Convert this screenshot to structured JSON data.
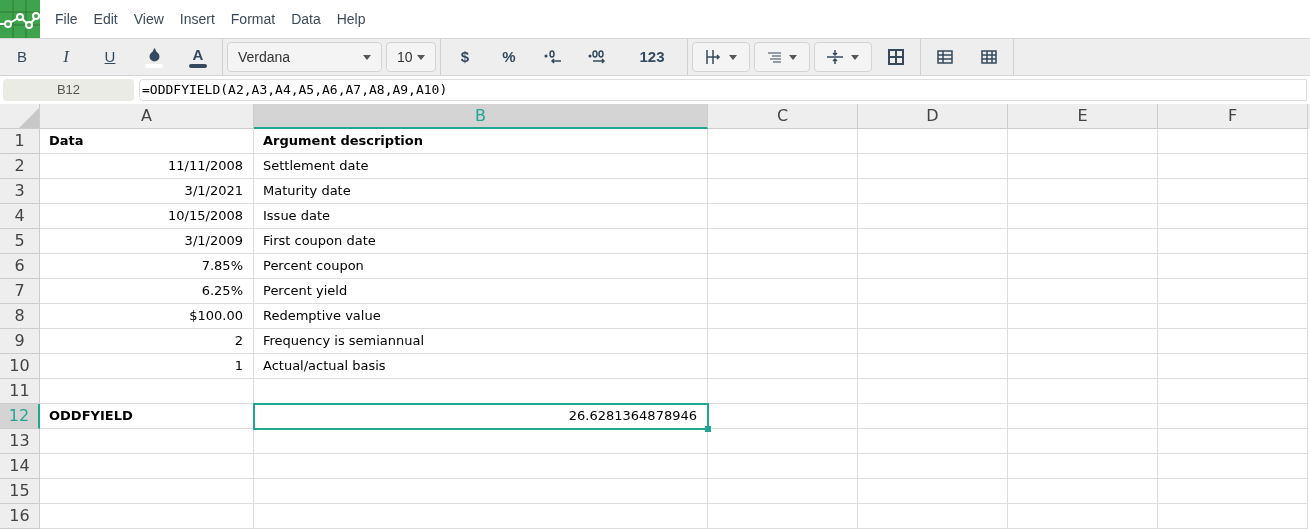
{
  "menu": [
    "File",
    "Edit",
    "View",
    "Insert",
    "Format",
    "Data",
    "Help"
  ],
  "toolbar": {
    "bold": "B",
    "italic": "I",
    "underline": "U",
    "text_color": "A",
    "currency": "$",
    "percent": "%",
    "font": "Verdana",
    "size": "10",
    "number_format": "123"
  },
  "formula_bar": {
    "cell": "B12",
    "formula": "=ODDFYIELD(A2,A3,A4,A5,A6,A7,A8,A9,A10)"
  },
  "columns": [
    {
      "label": "A",
      "selected": false
    },
    {
      "label": "B",
      "selected": true
    },
    {
      "label": "C",
      "selected": false
    },
    {
      "label": "D",
      "selected": false
    },
    {
      "label": "E",
      "selected": false
    },
    {
      "label": "F",
      "selected": false
    }
  ],
  "rows": [
    {
      "number": "1",
      "selected": false,
      "cells": [
        {
          "text": "Data",
          "kind": "text",
          "bold": true,
          "selected": false
        },
        {
          "text": "Argument description",
          "kind": "text",
          "bold": true,
          "selected": false
        }
      ]
    },
    {
      "number": "2",
      "selected": false,
      "cells": [
        {
          "text": "11/11/2008",
          "kind": "number",
          "bold": false,
          "selected": false
        },
        {
          "text": "Settlement date",
          "kind": "text",
          "bold": false,
          "selected": false
        }
      ]
    },
    {
      "number": "3",
      "selected": false,
      "cells": [
        {
          "text": "3/1/2021",
          "kind": "number",
          "bold": false,
          "selected": false
        },
        {
          "text": "Maturity date",
          "kind": "text",
          "bold": false,
          "selected": false
        }
      ]
    },
    {
      "number": "4",
      "selected": false,
      "cells": [
        {
          "text": "10/15/2008",
          "kind": "number",
          "bold": false,
          "selected": false
        },
        {
          "text": "Issue date",
          "kind": "text",
          "bold": false,
          "selected": false
        }
      ]
    },
    {
      "number": "5",
      "selected": false,
      "cells": [
        {
          "text": "3/1/2009",
          "kind": "number",
          "bold": false,
          "selected": false
        },
        {
          "text": "First coupon date",
          "kind": "text",
          "bold": false,
          "selected": false
        }
      ]
    },
    {
      "number": "6",
      "selected": false,
      "cells": [
        {
          "text": "7.85%",
          "kind": "number",
          "bold": false,
          "selected": false
        },
        {
          "text": "Percent coupon",
          "kind": "text",
          "bold": false,
          "selected": false
        }
      ]
    },
    {
      "number": "7",
      "selected": false,
      "cells": [
        {
          "text": "6.25%",
          "kind": "number",
          "bold": false,
          "selected": false
        },
        {
          "text": "Percent yield",
          "kind": "text",
          "bold": false,
          "selected": false
        }
      ]
    },
    {
      "number": "8",
      "selected": false,
      "cells": [
        {
          "text": "$100.00",
          "kind": "number",
          "bold": false,
          "selected": false
        },
        {
          "text": "Redemptive value",
          "kind": "text",
          "bold": false,
          "selected": false
        }
      ]
    },
    {
      "number": "9",
      "selected": false,
      "cells": [
        {
          "text": "2",
          "kind": "number",
          "bold": false,
          "selected": false
        },
        {
          "text": "Frequency is semiannual",
          "kind": "text",
          "bold": false,
          "selected": false
        }
      ]
    },
    {
      "number": "10",
      "selected": false,
      "cells": [
        {
          "text": "1",
          "kind": "number",
          "bold": false,
          "selected": false
        },
        {
          "text": "Actual/actual basis",
          "kind": "text",
          "bold": false,
          "selected": false
        }
      ]
    },
    {
      "number": "11",
      "selected": false
    },
    {
      "number": "12",
      "selected": true,
      "cells": [
        {
          "text": "ODDFYIELD",
          "kind": "text",
          "bold": true,
          "selected": false
        },
        {
          "text": "26.6281364878946",
          "kind": "number",
          "bold": false,
          "selected": true
        }
      ]
    },
    {
      "number": "13",
      "selected": false
    },
    {
      "number": "14",
      "selected": false
    },
    {
      "number": "15",
      "selected": false
    },
    {
      "number": "16",
      "selected": false
    }
  ]
}
